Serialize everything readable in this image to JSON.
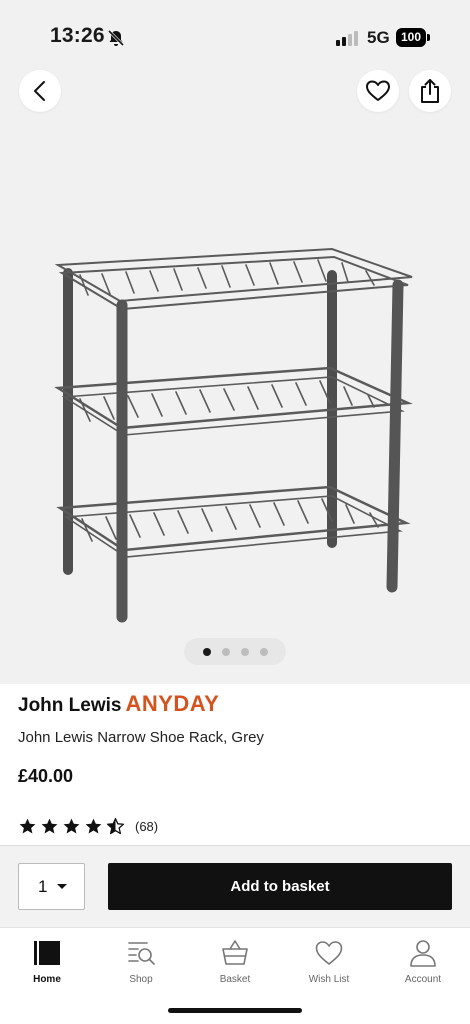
{
  "status": {
    "time": "13:26",
    "network": "5G",
    "battery": "100"
  },
  "header": {
    "back_icon": "chevron-left-icon",
    "wishlist_icon": "heart-outline-icon",
    "share_icon": "share-icon"
  },
  "gallery": {
    "image": "grey three-tier wire shoe rack",
    "total_images": 4,
    "active_index": 0
  },
  "product": {
    "brand": "John Lewis",
    "brand_sub": "ANYDAY",
    "title": "John Lewis Narrow Shoe Rack, Grey",
    "price": "£40.00",
    "rating": 4.5,
    "rating_max": 5,
    "review_count": "(68)"
  },
  "purchase": {
    "quantity": "1",
    "add_label": "Add to basket"
  },
  "tabs": [
    {
      "label": "Home",
      "icon": "home-icon",
      "active": true
    },
    {
      "label": "Shop",
      "icon": "shop-search-icon",
      "active": false
    },
    {
      "label": "Basket",
      "icon": "basket-icon",
      "active": false
    },
    {
      "label": "Wish List",
      "icon": "heart-icon",
      "active": false
    },
    {
      "label": "Account",
      "icon": "account-icon",
      "active": false
    }
  ],
  "colors": {
    "accent": "#d4531f",
    "button": "#111111",
    "background": "#f2f1f1"
  }
}
